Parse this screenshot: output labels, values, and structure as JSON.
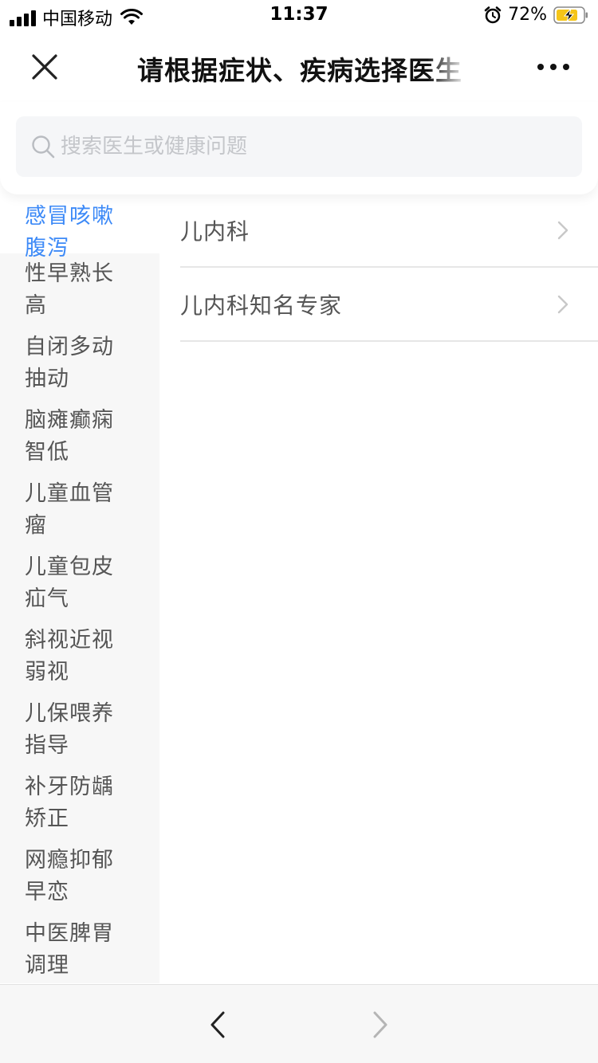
{
  "status_bar": {
    "carrier": "中国移动",
    "time": "11:37",
    "battery": "72%",
    "icons": [
      "signal-icon",
      "wifi-icon",
      "alarm-icon",
      "battery-charging-icon"
    ]
  },
  "nav": {
    "title": "请根据症状、疾病选择医生",
    "close_icon": "close-icon",
    "more_icon": "more-dots-icon"
  },
  "search": {
    "value": "",
    "placeholder": "搜索医生或健康问题"
  },
  "sidebar": {
    "active_index": 0,
    "items": [
      {
        "line1": "感冒咳嗽",
        "line2": "腹泻"
      },
      {
        "line1": "性早熟长",
        "line2": "高"
      },
      {
        "line1": "自闭多动",
        "line2": "抽动"
      },
      {
        "line1": "脑瘫癫痫",
        "line2": "智低"
      },
      {
        "line1": "儿童血管",
        "line2": "瘤"
      },
      {
        "line1": "儿童包皮",
        "line2": "疝气"
      },
      {
        "line1": "斜视近视",
        "line2": "弱视"
      },
      {
        "line1": "儿保喂养",
        "line2": "指导"
      },
      {
        "line1": "补牙防龋",
        "line2": "矫正"
      },
      {
        "line1": "网瘾抑郁",
        "line2": "早恋"
      },
      {
        "line1": "中医脾胃",
        "line2": "调理"
      }
    ]
  },
  "departments": [
    {
      "label": "儿内科"
    },
    {
      "label": "儿内科知名专家"
    }
  ],
  "colors": {
    "accent": "#3d8af7",
    "sidebar_bg": "#f7f7f7",
    "divider": "#e6e6e6",
    "placeholder": "#c4c6ca"
  }
}
